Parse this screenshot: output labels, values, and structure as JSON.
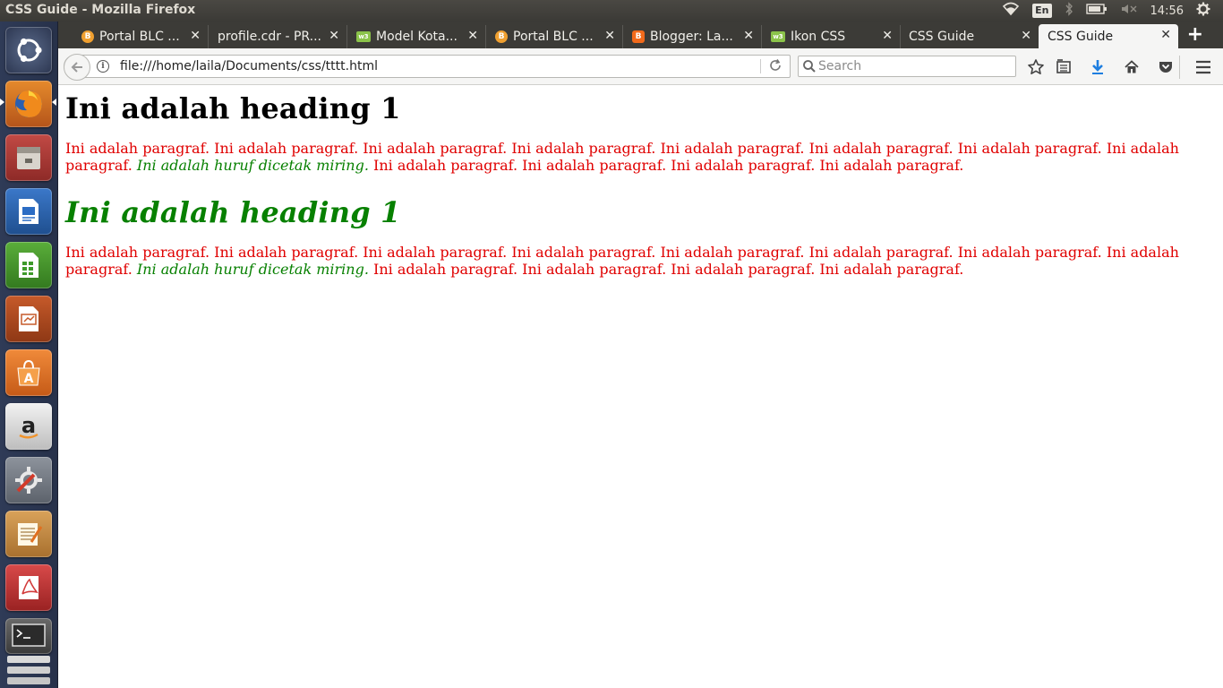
{
  "window": {
    "title": "CSS Guide - Mozilla Firefox"
  },
  "system": {
    "language": "En",
    "clock": "14:56"
  },
  "tabs": [
    {
      "label": "Portal BLC ...",
      "favicon": "blc",
      "active": false
    },
    {
      "label": "profile.cdr - PR...",
      "favicon": "none",
      "active": false
    },
    {
      "label": "Model Kota...",
      "favicon": "w3",
      "active": false
    },
    {
      "label": "Portal BLC ...",
      "favicon": "blc",
      "active": false
    },
    {
      "label": "Blogger: La...",
      "favicon": "blogger",
      "active": false
    },
    {
      "label": "Ikon CSS",
      "favicon": "w3",
      "active": false
    },
    {
      "label": "CSS Guide",
      "favicon": "none",
      "active": false
    },
    {
      "label": "CSS Guide",
      "favicon": "none",
      "active": true
    }
  ],
  "favicon_text": {
    "blc": "B",
    "w3": "w3",
    "blogger": "B"
  },
  "navbar": {
    "url": "file:///home/laila/Documents/css/tttt.html",
    "search_placeholder": "Search"
  },
  "launcher": [
    "ubuntu-dash-icon",
    "firefox-icon",
    "files-icon",
    "writer-icon",
    "calc-icon",
    "impress-icon",
    "software-center-icon",
    "amazon-icon",
    "system-settings-icon",
    "text-editor-icon",
    "pdf-reader-icon",
    "terminal-icon"
  ],
  "page": {
    "heading1": "Ini adalah heading 1",
    "para1_a": "Ini adalah paragraf. Ini adalah paragraf. Ini adalah paragraf. Ini adalah paragraf. Ini adalah paragraf. Ini adalah paragraf. Ini adalah paragraf. Ini adalah paragraf. ",
    "para1_em": "Ini adalah huruf dicetak miring.",
    "para1_b": " Ini adalah paragraf. Ini adalah paragraf. Ini adalah paragraf. Ini adalah paragraf.",
    "heading2": "Ini adalah heading 1",
    "para2_a": "Ini adalah paragraf. Ini adalah paragraf. Ini adalah paragraf. Ini adalah paragraf. Ini adalah paragraf. Ini adalah paragraf. Ini adalah paragraf. Ini adalah paragraf. ",
    "para2_em": "Ini adalah huruf dicetak miring.",
    "para2_b": " Ini adalah paragraf. Ini adalah paragraf. Ini adalah paragraf. Ini adalah paragraf."
  },
  "colors": {
    "heading_green": "#078000",
    "paragraph_red": "#e00000",
    "italic_green": "#078000"
  }
}
